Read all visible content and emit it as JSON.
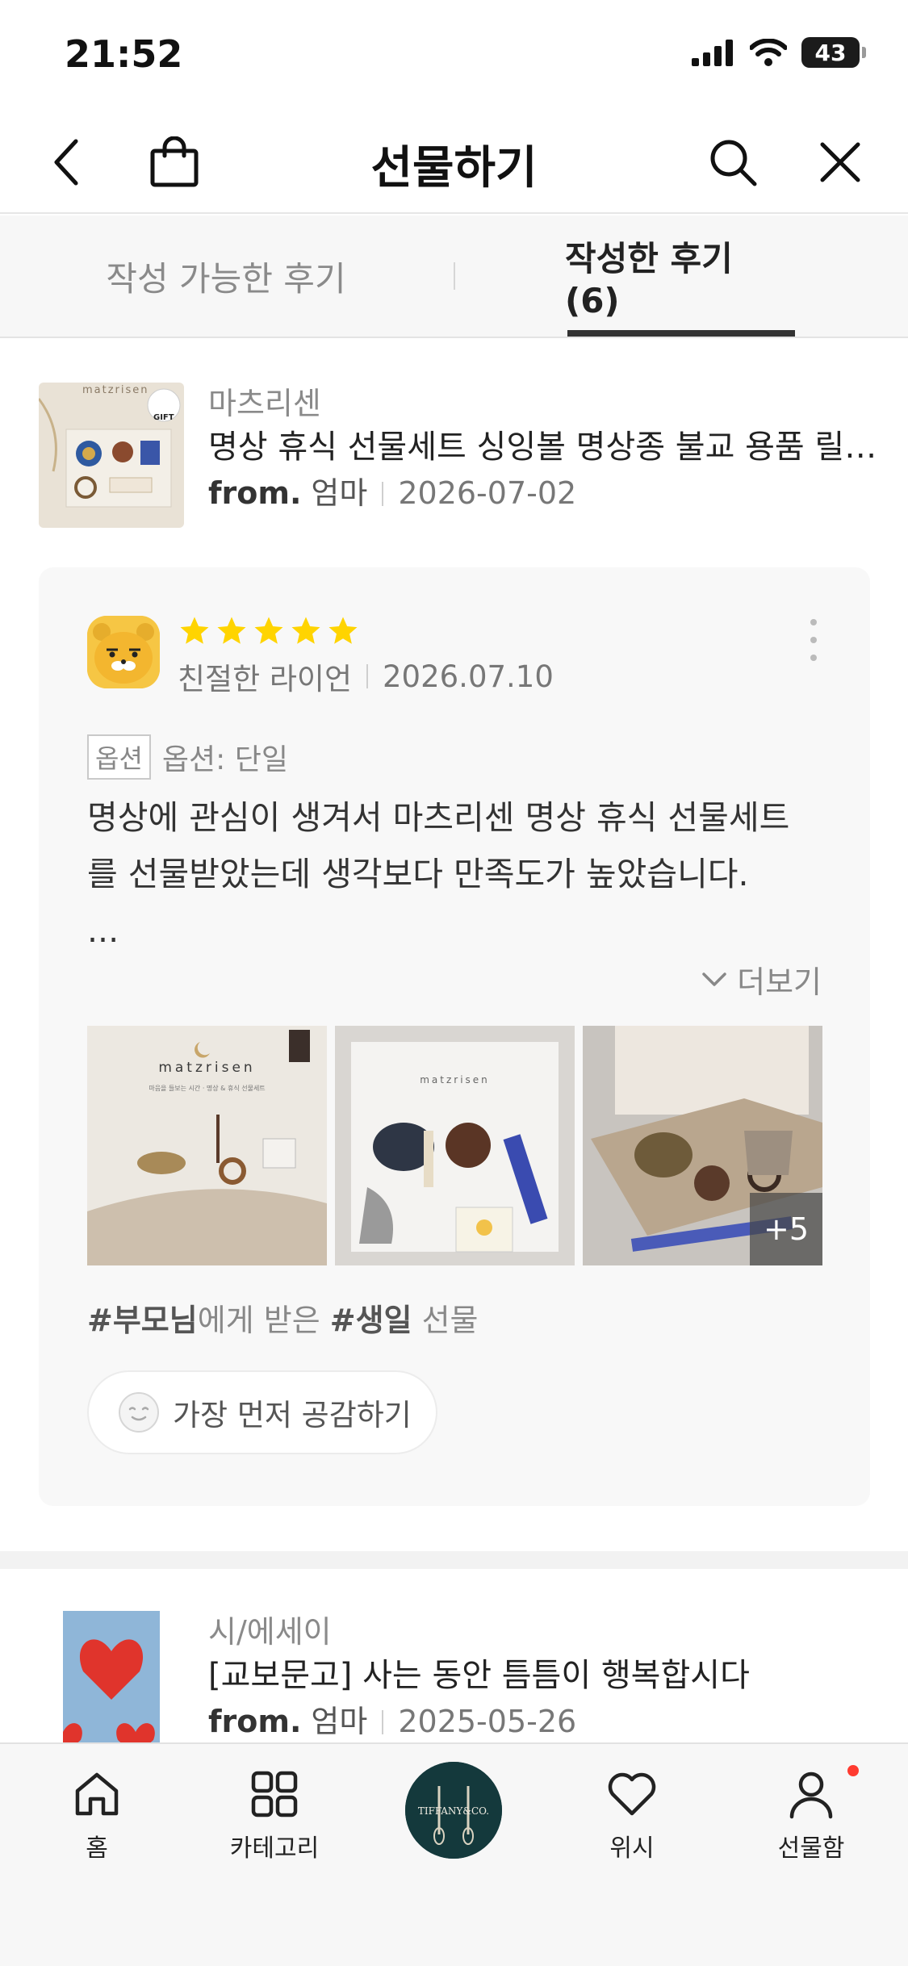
{
  "status_bar": {
    "time": "21:52",
    "battery": "43"
  },
  "header": {
    "title": "선물하기"
  },
  "tabs": [
    {
      "label": "작성 가능한 후기"
    },
    {
      "label": "작성한 후기 (6)"
    }
  ],
  "products": [
    {
      "category": "마츠리센",
      "name": "명상 휴식 선물세트 싱잉볼 명상종 불교 용품 릴렉스 힐링 선물",
      "from_label": "from.",
      "from_name": "엄마",
      "date": "2026-07-02",
      "thumb_brand": "matzrisen",
      "thumb_badge": "GIFT"
    },
    {
      "category": "시/에세이",
      "name": "[교보문고] 사는 동안 틈틈이 행복합시다",
      "from_label": "from.",
      "from_name": "엄마",
      "date": "2025-05-26"
    }
  ],
  "review": {
    "rating": 5,
    "reviewer": "친절한 라이언",
    "date": "2026.07.10",
    "option_badge": "옵션",
    "option_text": "옵션: 단일",
    "body": "명상에 관심이 생겨서 마츠리센 명상 휴식 선물세트\n를 선물받았는데 생각보다 만족도가 높았습니다.\n...",
    "read_more": "더보기",
    "photos": [
      {
        "brand": "matzrisen",
        "caption": "마음을 들보는 시간 · 명상 & 휴식 선물세트"
      },
      {
        "brand": "matzrisen"
      },
      {
        "more": "+5"
      }
    ],
    "tag_relation": "#부모님",
    "tag_middle": "에게 받은 ",
    "tag_occasion": "#생일",
    "tag_end": " 선물",
    "like_label": "가장 먼저 공감하기"
  },
  "bottom_nav": [
    {
      "label": "홈",
      "icon": "home-icon"
    },
    {
      "label": "카테고리",
      "icon": "grid-icon"
    },
    {
      "label": "TIFFANY&CO.",
      "icon": "brand-promo"
    },
    {
      "label": "위시",
      "icon": "heart-icon"
    },
    {
      "label": "선물함",
      "icon": "person-icon"
    }
  ],
  "colors": {
    "star": "#FFD400",
    "accent_dark": "#333333",
    "notify_dot": "#FF3B30"
  }
}
